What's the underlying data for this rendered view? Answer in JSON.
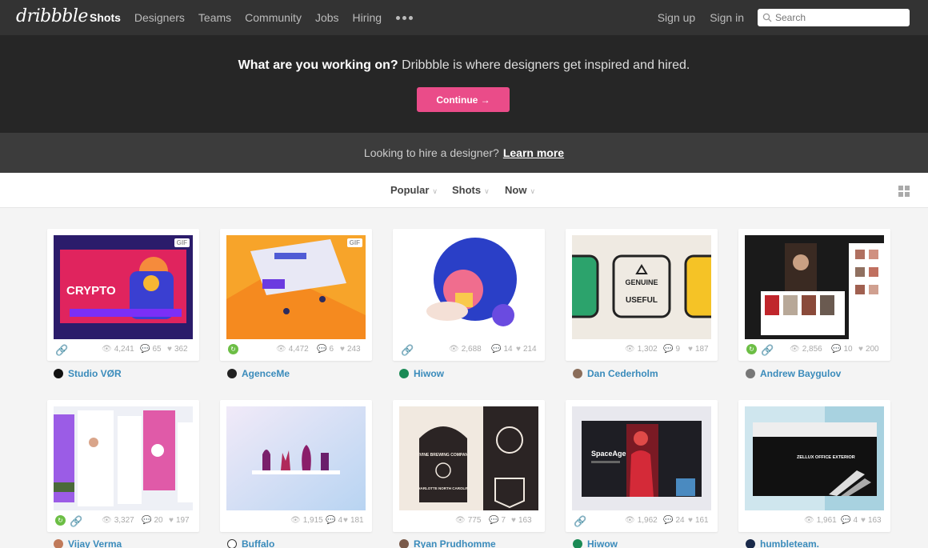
{
  "logo": "dribbble",
  "nav": {
    "items": [
      "Shots",
      "Designers",
      "Teams",
      "Community",
      "Jobs",
      "Hiring"
    ],
    "signup": "Sign up",
    "signin": "Sign in",
    "search_placeholder": "Search"
  },
  "hero": {
    "bold": "What are you working on?",
    "rest": " Dribbble is where designers get inspired and hired.",
    "button": "Continue →"
  },
  "hire": {
    "text": "Looking to hire a designer?",
    "link": "Learn more"
  },
  "filters": {
    "sort": "Popular",
    "type": "Shots",
    "time": "Now"
  },
  "shots": [
    {
      "author": "Studio VØR",
      "views": "4,241",
      "comments": "65",
      "likes": "362",
      "gif": "GIF"
    },
    {
      "author": "AgenceMe",
      "views": "4,472",
      "comments": "6",
      "likes": "243",
      "gif": "GIF"
    },
    {
      "author": "Hiwow",
      "views": "2,688",
      "comments": "14",
      "likes": "214"
    },
    {
      "author": "Dan Cederholm",
      "views": "1,302",
      "comments": "9",
      "likes": "187"
    },
    {
      "author": "Andrew Baygulov",
      "views": "2,856",
      "comments": "10",
      "likes": "200"
    },
    {
      "author": "Vijay Verma",
      "views": "3,327",
      "comments": "20",
      "likes": "197"
    },
    {
      "author": "Buffalo",
      "views": "1,915",
      "comments": "4",
      "likes": "181"
    },
    {
      "author": "Ryan Prudhomme",
      "views": "775",
      "comments": "7",
      "likes": "163"
    },
    {
      "author": "Hiwow",
      "views": "1,962",
      "comments": "24",
      "likes": "161"
    },
    {
      "author": "humbleteam.",
      "views": "1,961",
      "comments": "4",
      "likes": "163"
    }
  ],
  "thumb_text": {
    "crypto": "CRYPTO",
    "genuine": "GENUINE",
    "useful": "USEFUL",
    "divine": "DIVINE BREWING COMPANY",
    "charlotte": "CHARLOTTE NORTH CAROLINA",
    "spaceage": "SpaceAge",
    "zellux": "ZELLUX OFFICE EXTERIOR"
  },
  "colors": {
    "accent": "#ea4c89",
    "link": "#3a8bbb",
    "rebound": "#6cbe45"
  }
}
